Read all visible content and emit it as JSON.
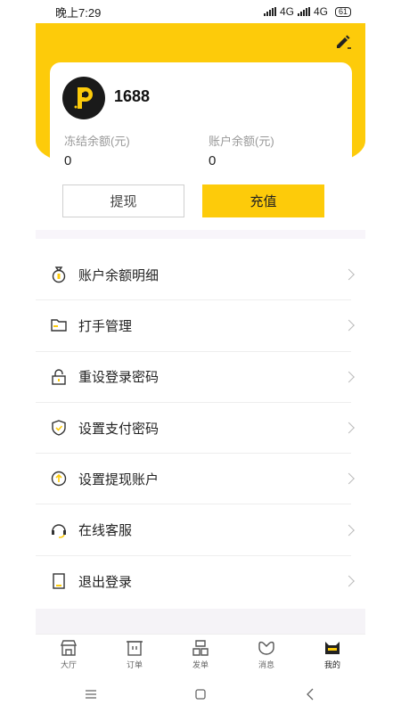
{
  "status": {
    "time": "晚上7:29",
    "network1": "4G",
    "network2": "4G",
    "battery": "61"
  },
  "profile": {
    "username": "1688",
    "frozen_label": "冻结余额(元)",
    "frozen_value": "0",
    "balance_label": "账户余额(元)",
    "balance_value": "0"
  },
  "actions": {
    "withdraw_label": "提现",
    "recharge_label": "充值"
  },
  "menu": [
    {
      "label": "账户余额明细",
      "icon": "money-bag-icon"
    },
    {
      "label": "打手管理",
      "icon": "folder-icon"
    },
    {
      "label": "重设登录密码",
      "icon": "lock-icon"
    },
    {
      "label": "设置支付密码",
      "icon": "shield-icon"
    },
    {
      "label": "设置提现账户",
      "icon": "upload-circle-icon"
    },
    {
      "label": "在线客服",
      "icon": "headset-icon"
    },
    {
      "label": "退出登录",
      "icon": "tablet-icon"
    }
  ],
  "tabs": [
    {
      "label": "大厅",
      "icon": "hall-icon"
    },
    {
      "label": "订单",
      "icon": "order-icon"
    },
    {
      "label": "发单",
      "icon": "post-order-icon"
    },
    {
      "label": "消息",
      "icon": "message-icon"
    },
    {
      "label": "我的",
      "icon": "mine-icon"
    }
  ],
  "colors": {
    "accent": "#FDCB0A",
    "icon_dark": "#333333",
    "icon_yellow": "#FDCB0A"
  }
}
